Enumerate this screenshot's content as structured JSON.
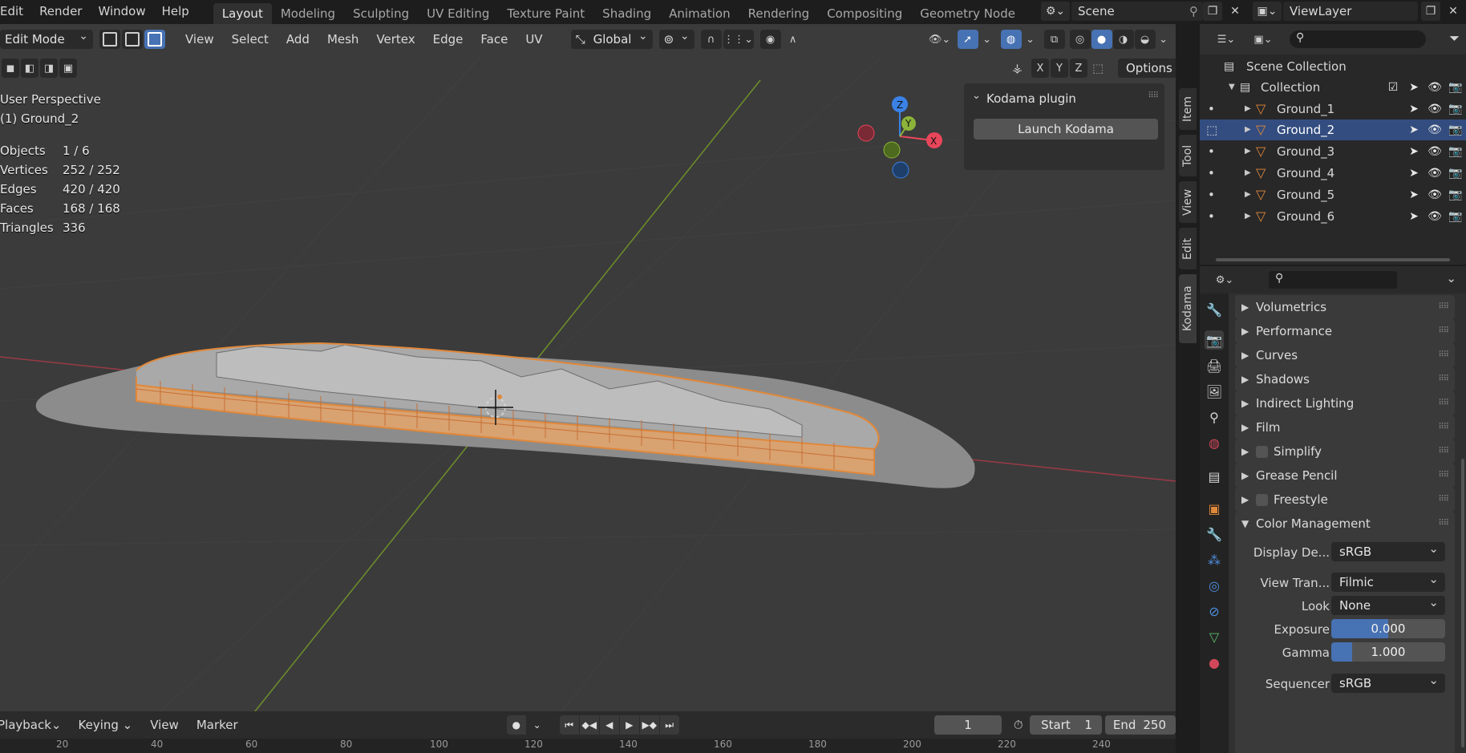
{
  "top_menu": [
    "Edit",
    "Render",
    "Window",
    "Help"
  ],
  "workspaces": [
    {
      "label": "Layout",
      "active": true
    },
    {
      "label": "Modeling"
    },
    {
      "label": "Sculpting"
    },
    {
      "label": "UV Editing"
    },
    {
      "label": "Texture Paint"
    },
    {
      "label": "Shading"
    },
    {
      "label": "Animation"
    },
    {
      "label": "Rendering"
    },
    {
      "label": "Compositing"
    },
    {
      "label": "Geometry Node"
    }
  ],
  "scene": {
    "name": "Scene",
    "view_layer": "ViewLayer"
  },
  "viewport": {
    "mode": "Edit Mode",
    "menus": [
      "View",
      "Select",
      "Add",
      "Mesh",
      "Vertex",
      "Edge",
      "Face",
      "UV"
    ],
    "transform_orientation": "Global",
    "options_label": "Options",
    "axis_lock": [
      "X",
      "Y",
      "Z"
    ],
    "perspective": "User Perspective",
    "active_object": "(1) Ground_2",
    "stats": [
      {
        "key": "Objects",
        "value": "1 / 6"
      },
      {
        "key": "Vertices",
        "value": "252 / 252"
      },
      {
        "key": "Edges",
        "value": "420 / 420"
      },
      {
        "key": "Faces",
        "value": "168 / 168"
      },
      {
        "key": "Triangles",
        "value": "336"
      }
    ],
    "gizmo": {
      "z": "Z",
      "y": "Y",
      "x": "X"
    },
    "kodama_panel": {
      "title": "Kodama plugin",
      "button": "Launch Kodama"
    },
    "side_tabs": [
      "Item",
      "Tool",
      "View",
      "Edit",
      "Kodama"
    ]
  },
  "timeline": {
    "playback": "Playback",
    "keying": "Keying",
    "menus": [
      "View",
      "Marker"
    ],
    "current_frame": "1",
    "start_label": "Start",
    "start": "1",
    "end_label": "End",
    "end": "250",
    "ruler": [
      "20",
      "40",
      "60",
      "80",
      "100",
      "120",
      "140",
      "160",
      "180",
      "200",
      "220",
      "240"
    ]
  },
  "outliner": {
    "scene_collection": "Scene Collection",
    "collection": "Collection",
    "objects": [
      {
        "name": "Ground_1",
        "selected": false
      },
      {
        "name": "Ground_2",
        "selected": true
      },
      {
        "name": "Ground_3",
        "selected": false
      },
      {
        "name": "Ground_4",
        "selected": false
      },
      {
        "name": "Ground_5",
        "selected": false
      },
      {
        "name": "Ground_6",
        "selected": false
      }
    ]
  },
  "properties": {
    "sections": [
      {
        "label": "Volumetrics",
        "checkbox": false
      },
      {
        "label": "Performance",
        "checkbox": false
      },
      {
        "label": "Curves",
        "checkbox": false
      },
      {
        "label": "Shadows",
        "checkbox": false
      },
      {
        "label": "Indirect Lighting",
        "checkbox": false
      },
      {
        "label": "Film",
        "checkbox": false
      },
      {
        "label": "Simplify",
        "checkbox": true
      },
      {
        "label": "Grease Pencil",
        "checkbox": false
      },
      {
        "label": "Freestyle",
        "checkbox": true
      }
    ],
    "color_management": {
      "title": "Color Management",
      "display_device_label": "Display De...",
      "display_device": "sRGB",
      "view_transform_label": "View Tran...",
      "view_transform": "Filmic",
      "look_label": "Look",
      "look": "None",
      "exposure_label": "Exposure",
      "exposure": "0.000",
      "gamma_label": "Gamma",
      "gamma": "1.000",
      "sequencer_label": "Sequencer",
      "sequencer": "sRGB"
    }
  },
  "colors": {
    "accent": "#4772b3",
    "selection_orange": "#e0883a",
    "x_axis": "#e8465a",
    "y_axis": "#8cb33a",
    "z_axis": "#3a82e6"
  }
}
